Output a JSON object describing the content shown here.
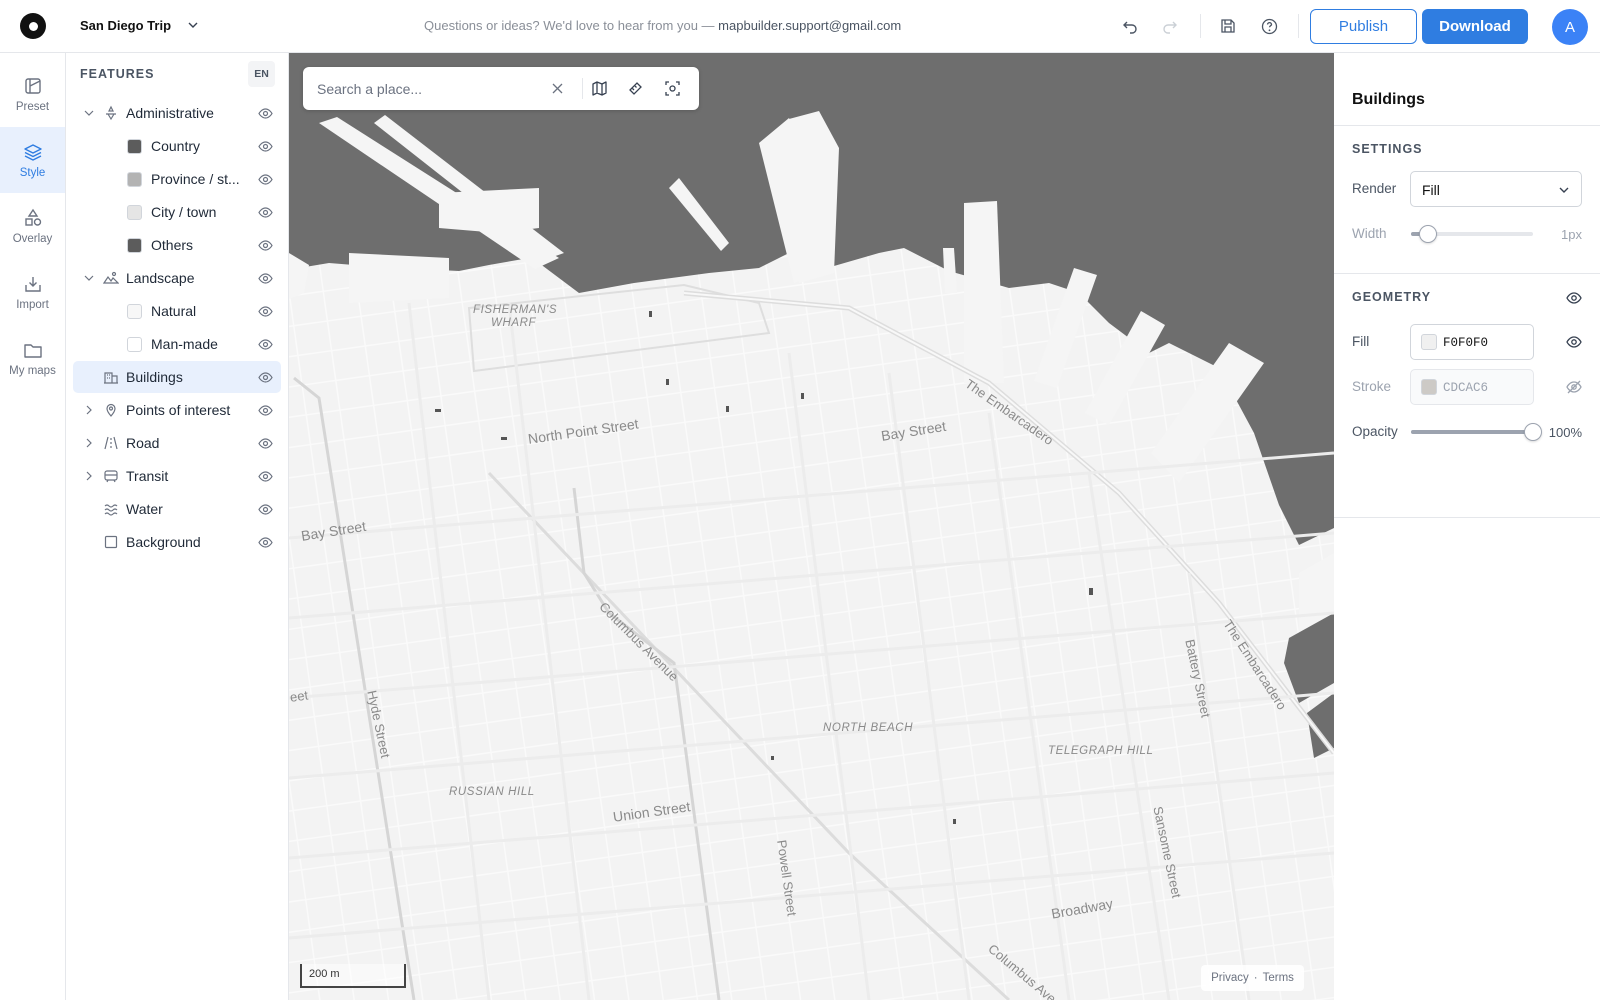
{
  "topbar": {
    "project_name": "San Diego Trip",
    "feedback_text": "Questions or ideas? We'd love to hear from you — ",
    "feedback_email": "mapbuilder.support@gmail.com",
    "publish_label": "Publish",
    "download_label": "Download",
    "avatar_initial": "A"
  },
  "rail": {
    "items": [
      {
        "label": "Preset",
        "icon": "preset-icon"
      },
      {
        "label": "Style",
        "icon": "layers-icon",
        "active": true
      },
      {
        "label": "Overlay",
        "icon": "shapes-icon"
      },
      {
        "label": "Import",
        "icon": "import-icon"
      },
      {
        "label": "My maps",
        "icon": "folder-icon"
      }
    ]
  },
  "features": {
    "title": "FEATURES",
    "lang_badge": "EN",
    "rows": [
      {
        "label": "Administrative",
        "level": 0,
        "expanded": true,
        "icon": "administrative-icon"
      },
      {
        "label": "Country",
        "level": 1,
        "swatch": "#5c5c5c"
      },
      {
        "label": "Province / st...",
        "level": 1,
        "swatch": "#b3b3b3"
      },
      {
        "label": "City / town",
        "level": 1,
        "swatch": "#e5e5e5"
      },
      {
        "label": "Others",
        "level": 1,
        "swatch": "#5c5c5c"
      },
      {
        "label": "Landscape",
        "level": 0,
        "expanded": true,
        "icon": "landscape-icon"
      },
      {
        "label": "Natural",
        "level": 1,
        "swatch": "#f7f7f7"
      },
      {
        "label": "Man-made",
        "level": 1,
        "swatch": "#ffffff"
      },
      {
        "label": "Buildings",
        "level": 0,
        "selected": true,
        "icon": "buildings-icon"
      },
      {
        "label": "Points of interest",
        "level": 0,
        "collapsed": true,
        "icon": "poi-icon"
      },
      {
        "label": "Road",
        "level": 0,
        "collapsed": true,
        "icon": "road-icon"
      },
      {
        "label": "Transit",
        "level": 0,
        "collapsed": true,
        "icon": "transit-icon"
      },
      {
        "label": "Water",
        "level": 0,
        "icon": "water-icon"
      },
      {
        "label": "Background",
        "level": 0,
        "icon": "background-icon"
      }
    ]
  },
  "map": {
    "search_placeholder": "Search a place...",
    "scale_label": "200 m",
    "privacy": "Privacy",
    "terms": "Terms",
    "labels": {
      "fishermans": "FISHERMAN'S",
      "wharf": "WHARF",
      "north_point": "North Point Street",
      "bay1": "Bay Street",
      "bay2": "Bay Street",
      "embarcadero1": "The Embarcadero",
      "embarcadero2": "The Embarcadero",
      "columbus1": "Columbus Avenue",
      "columbus2": "Columbus Ave",
      "hyde": "Hyde Street",
      "north_beach": "NORTH BEACH",
      "telegraph": "TELEGRAPH HILL",
      "russian": "RUSSIAN HILL",
      "union": "Union Street",
      "powell": "Powell Street",
      "sansome": "Sansome Street",
      "battery": "Battery Street",
      "broadway": "Broadway",
      "cut_left": "eet"
    }
  },
  "panel": {
    "title": "Buildings",
    "settings_header": "SETTINGS",
    "render_label": "Render",
    "render_value": "Fill",
    "width_label": "Width",
    "width_value": "1px",
    "width_level": 0.14,
    "geometry_header": "GEOMETRY",
    "fill_label": "Fill",
    "fill_value": "F0F0F0",
    "fill_color": "#F0F0F0",
    "stroke_label": "Stroke",
    "stroke_value": "CDCAC6",
    "stroke_color": "#CDCAC6",
    "opacity_label": "Opacity",
    "opacity_value": "100%",
    "opacity_level": 1.0
  },
  "colors": {
    "accent": "#2f7de1",
    "water": "#6e6e6e",
    "land": "#f5f5f5"
  }
}
